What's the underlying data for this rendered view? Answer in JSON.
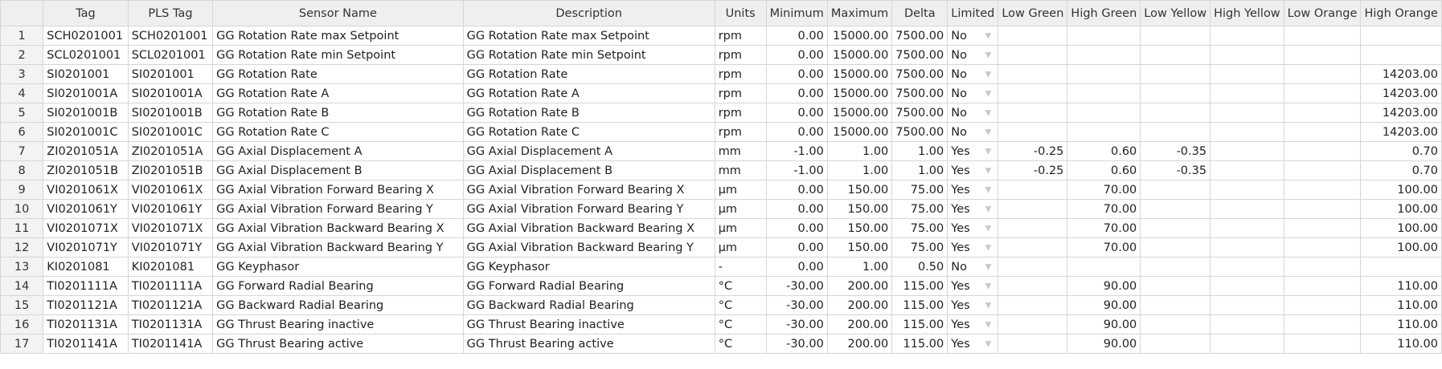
{
  "headers": {
    "tag": "Tag",
    "pls_tag": "PLS Tag",
    "sensor_name": "Sensor Name",
    "description": "Description",
    "units": "Units",
    "minimum": "Minimum",
    "maximum": "Maximum",
    "delta": "Delta",
    "limited": "Limited",
    "low_green": "Low Green",
    "high_green": "High Green",
    "low_yellow": "Low Yellow",
    "high_yellow": "High Yellow",
    "low_orange": "Low Orange",
    "high_orange": "High Orange"
  },
  "dropdown_icon": "chevron-down-icon",
  "rows": [
    {
      "num": "1",
      "tag": "SCH0201001",
      "pls": "SCH0201001",
      "name": "GG Rotation Rate max Setpoint",
      "desc": "GG Rotation Rate max Setpoint",
      "units": "rpm",
      "min": "0.00",
      "max": "15000.00",
      "delta": "7500.00",
      "limited": "No",
      "lg": "",
      "hg": "",
      "ly": "",
      "hy": "",
      "lo": "",
      "ho": ""
    },
    {
      "num": "2",
      "tag": "SCL0201001",
      "pls": "SCL0201001",
      "name": "GG Rotation Rate min Setpoint",
      "desc": "GG Rotation Rate min Setpoint",
      "units": "rpm",
      "min": "0.00",
      "max": "15000.00",
      "delta": "7500.00",
      "limited": "No",
      "lg": "",
      "hg": "",
      "ly": "",
      "hy": "",
      "lo": "",
      "ho": ""
    },
    {
      "num": "3",
      "tag": "SI0201001",
      "pls": "SI0201001",
      "name": "GG Rotation Rate",
      "desc": "GG Rotation Rate",
      "units": "rpm",
      "min": "0.00",
      "max": "15000.00",
      "delta": "7500.00",
      "limited": "No",
      "lg": "",
      "hg": "",
      "ly": "",
      "hy": "",
      "lo": "",
      "ho": "14203.00"
    },
    {
      "num": "4",
      "tag": "SI0201001A",
      "pls": "SI0201001A",
      "name": "GG Rotation Rate A",
      "desc": "GG Rotation Rate A",
      "units": "rpm",
      "min": "0.00",
      "max": "15000.00",
      "delta": "7500.00",
      "limited": "No",
      "lg": "",
      "hg": "",
      "ly": "",
      "hy": "",
      "lo": "",
      "ho": "14203.00"
    },
    {
      "num": "5",
      "tag": "SI0201001B",
      "pls": "SI0201001B",
      "name": "GG Rotation Rate B",
      "desc": "GG Rotation Rate B",
      "units": "rpm",
      "min": "0.00",
      "max": "15000.00",
      "delta": "7500.00",
      "limited": "No",
      "lg": "",
      "hg": "",
      "ly": "",
      "hy": "",
      "lo": "",
      "ho": "14203.00"
    },
    {
      "num": "6",
      "tag": "SI0201001C",
      "pls": "SI0201001C",
      "name": "GG Rotation Rate C",
      "desc": "GG Rotation Rate C",
      "units": "rpm",
      "min": "0.00",
      "max": "15000.00",
      "delta": "7500.00",
      "limited": "No",
      "lg": "",
      "hg": "",
      "ly": "",
      "hy": "",
      "lo": "",
      "ho": "14203.00"
    },
    {
      "num": "7",
      "tag": "ZI0201051A",
      "pls": "ZI0201051A",
      "name": "GG Axial Displacement A",
      "desc": "GG Axial Displacement A",
      "units": "mm",
      "min": "-1.00",
      "max": "1.00",
      "delta": "1.00",
      "limited": "Yes",
      "lg": "-0.25",
      "hg": "0.60",
      "ly": "-0.35",
      "hy": "",
      "lo": "",
      "ho": "0.70"
    },
    {
      "num": "8",
      "tag": "ZI0201051B",
      "pls": "ZI0201051B",
      "name": "GG Axial Displacement B",
      "desc": "GG Axial Displacement B",
      "units": "mm",
      "min": "-1.00",
      "max": "1.00",
      "delta": "1.00",
      "limited": "Yes",
      "lg": "-0.25",
      "hg": "0.60",
      "ly": "-0.35",
      "hy": "",
      "lo": "",
      "ho": "0.70"
    },
    {
      "num": "9",
      "tag": "VI0201061X",
      "pls": "VI0201061X",
      "name": "GG Axial Vibration Forward Bearing X",
      "desc": "GG Axial Vibration Forward Bearing X",
      "units": "µm",
      "min": "0.00",
      "max": "150.00",
      "delta": "75.00",
      "limited": "Yes",
      "lg": "",
      "hg": "70.00",
      "ly": "",
      "hy": "",
      "lo": "",
      "ho": "100.00"
    },
    {
      "num": "10",
      "tag": "VI0201061Y",
      "pls": "VI0201061Y",
      "name": "GG Axial Vibration Forward Bearing Y",
      "desc": "GG Axial Vibration Forward Bearing Y",
      "units": "µm",
      "min": "0.00",
      "max": "150.00",
      "delta": "75.00",
      "limited": "Yes",
      "lg": "",
      "hg": "70.00",
      "ly": "",
      "hy": "",
      "lo": "",
      "ho": "100.00"
    },
    {
      "num": "11",
      "tag": "VI0201071X",
      "pls": "VI0201071X",
      "name": "GG Axial Vibration Backward Bearing X",
      "desc": "GG Axial Vibration Backward Bearing X",
      "units": "µm",
      "min": "0.00",
      "max": "150.00",
      "delta": "75.00",
      "limited": "Yes",
      "lg": "",
      "hg": "70.00",
      "ly": "",
      "hy": "",
      "lo": "",
      "ho": "100.00"
    },
    {
      "num": "12",
      "tag": "VI0201071Y",
      "pls": "VI0201071Y",
      "name": "GG Axial Vibration Backward Bearing Y",
      "desc": "GG Axial Vibration Backward Bearing Y",
      "units": "µm",
      "min": "0.00",
      "max": "150.00",
      "delta": "75.00",
      "limited": "Yes",
      "lg": "",
      "hg": "70.00",
      "ly": "",
      "hy": "",
      "lo": "",
      "ho": "100.00"
    },
    {
      "num": "13",
      "tag": "KI0201081",
      "pls": "KI0201081",
      "name": "GG Keyphasor",
      "desc": "GG Keyphasor",
      "units": "-",
      "min": "0.00",
      "max": "1.00",
      "delta": "0.50",
      "limited": "No",
      "lg": "",
      "hg": "",
      "ly": "",
      "hy": "",
      "lo": "",
      "ho": ""
    },
    {
      "num": "14",
      "tag": "TI0201111A",
      "pls": "TI0201111A",
      "name": "GG Forward Radial Bearing",
      "desc": "GG Forward Radial Bearing",
      "units": "°C",
      "min": "-30.00",
      "max": "200.00",
      "delta": "115.00",
      "limited": "Yes",
      "lg": "",
      "hg": "90.00",
      "ly": "",
      "hy": "",
      "lo": "",
      "ho": "110.00"
    },
    {
      "num": "15",
      "tag": "TI0201121A",
      "pls": "TI0201121A",
      "name": "GG Backward Radial Bearing",
      "desc": "GG Backward Radial Bearing",
      "units": "°C",
      "min": "-30.00",
      "max": "200.00",
      "delta": "115.00",
      "limited": "Yes",
      "lg": "",
      "hg": "90.00",
      "ly": "",
      "hy": "",
      "lo": "",
      "ho": "110.00"
    },
    {
      "num": "16",
      "tag": "TI0201131A",
      "pls": "TI0201131A",
      "name": "GG Thrust Bearing inactive",
      "desc": "GG Thrust Bearing inactive",
      "units": "°C",
      "min": "-30.00",
      "max": "200.00",
      "delta": "115.00",
      "limited": "Yes",
      "lg": "",
      "hg": "90.00",
      "ly": "",
      "hy": "",
      "lo": "",
      "ho": "110.00"
    },
    {
      "num": "17",
      "tag": "TI0201141A",
      "pls": "TI0201141A",
      "name": "GG Thrust Bearing active",
      "desc": "GG Thrust Bearing active",
      "units": "°C",
      "min": "-30.00",
      "max": "200.00",
      "delta": "115.00",
      "limited": "Yes",
      "lg": "",
      "hg": "90.00",
      "ly": "",
      "hy": "",
      "lo": "",
      "ho": "110.00"
    }
  ]
}
